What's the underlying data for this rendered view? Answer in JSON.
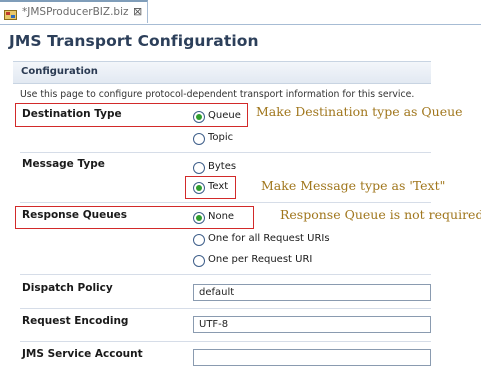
{
  "tab": {
    "label": "*JMSProducerBIZ.biz",
    "close": "⊠"
  },
  "page": {
    "title": "JMS Transport Configuration",
    "section_title": "Configuration",
    "description": "Use this page to configure protocol-dependent transport information for this service."
  },
  "destination_type": {
    "label": "Destination Type",
    "options": [
      "Queue",
      "Topic"
    ],
    "selected": "Queue"
  },
  "message_type": {
    "label": "Message Type",
    "options": [
      "Bytes",
      "Text"
    ],
    "selected": "Text"
  },
  "response_queues": {
    "label": "Response Queues",
    "options": [
      "None",
      "One for all Request URIs",
      "One per Request URI"
    ],
    "selected": "None"
  },
  "dispatch_policy": {
    "label": "Dispatch Policy",
    "value": "default"
  },
  "request_encoding": {
    "label": "Request Encoding",
    "value": "UTF-8"
  },
  "jms_service_account": {
    "label": "JMS Service Account",
    "value": ""
  },
  "annotations": {
    "destination": "Make Destination type as Queue",
    "message": "Make Message type as 'Text\"",
    "response": "Response Queue is not required"
  },
  "colors": {
    "annotation": "#a0761c",
    "highlight_box": "#d22a2a",
    "radio_selected": "#2f9e2f",
    "title": "#2c3f5a"
  }
}
